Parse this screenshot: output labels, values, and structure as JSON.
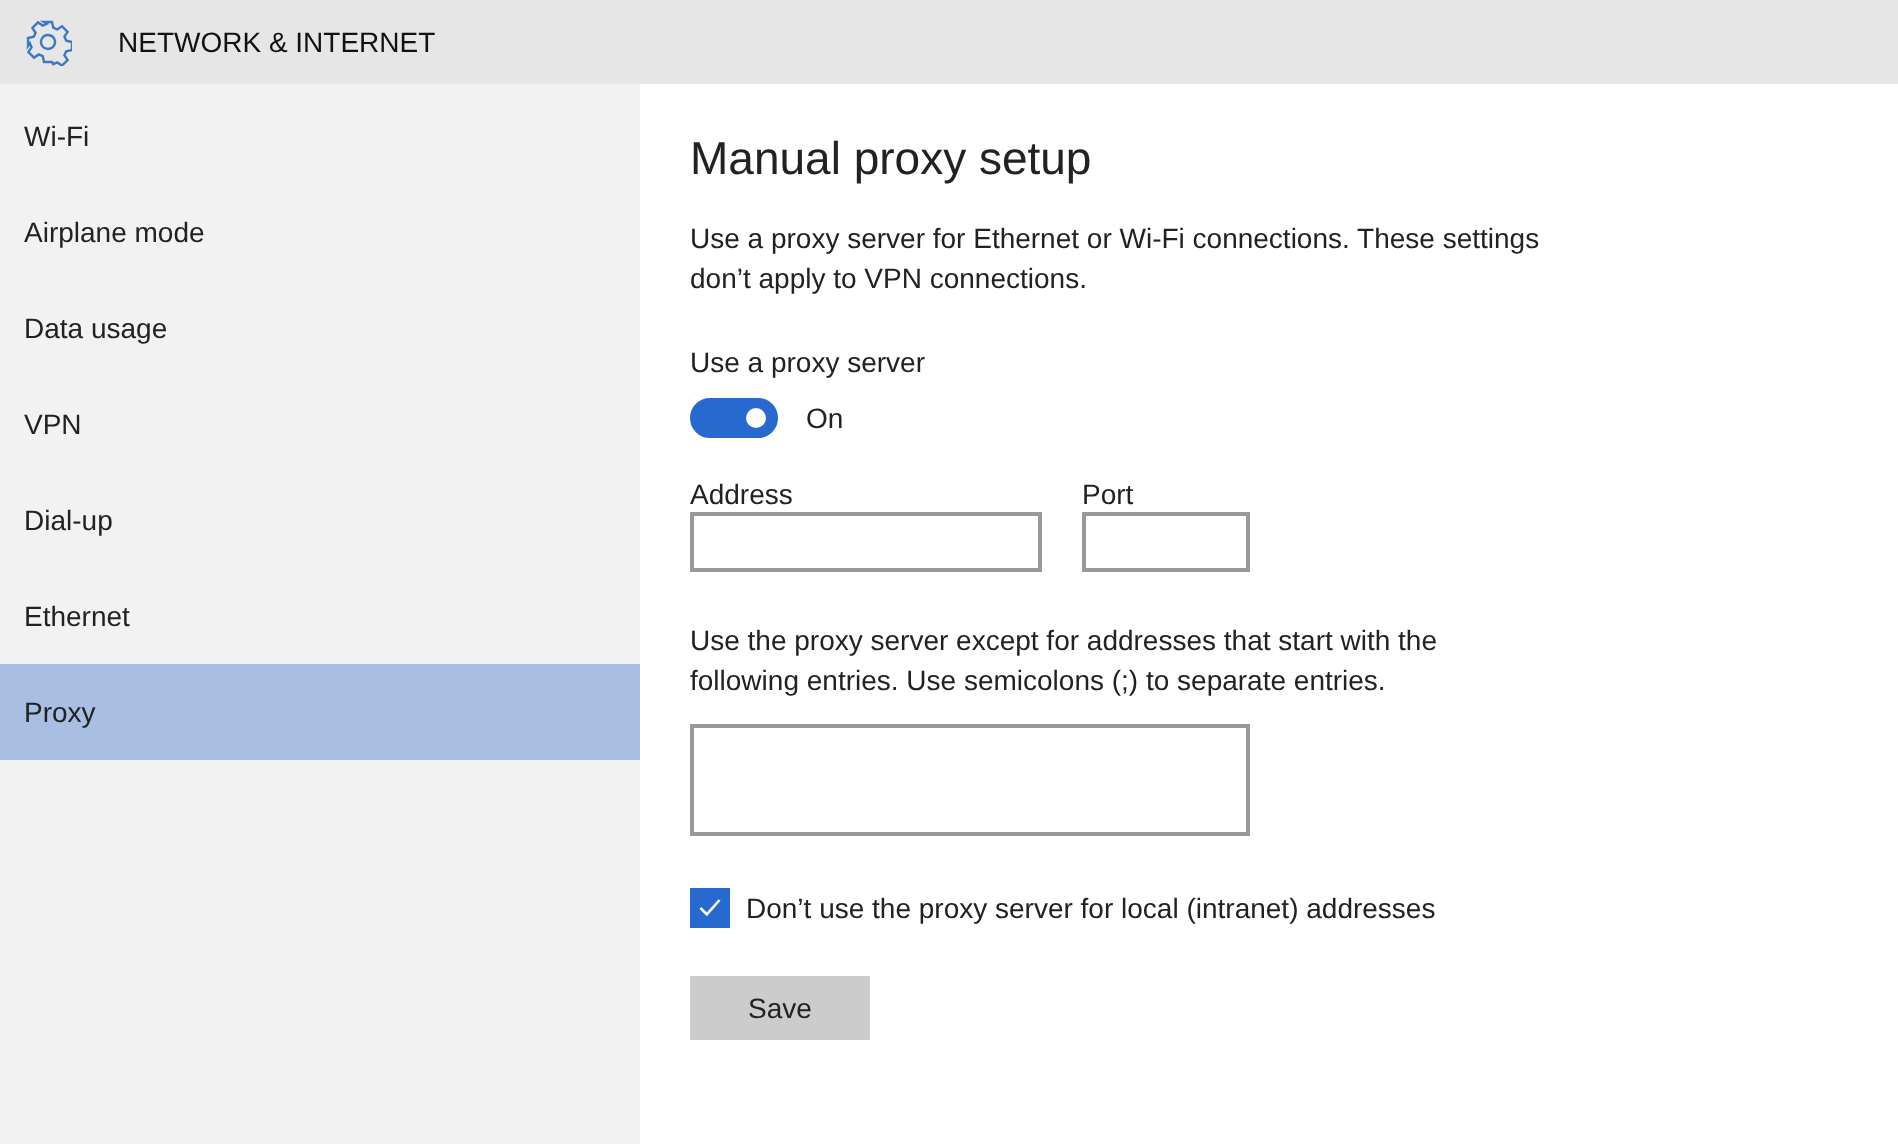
{
  "header": {
    "title": "NETWORK & INTERNET"
  },
  "sidebar": {
    "items": [
      {
        "label": "Wi-Fi",
        "selected": false
      },
      {
        "label": "Airplane mode",
        "selected": false
      },
      {
        "label": "Data usage",
        "selected": false
      },
      {
        "label": "VPN",
        "selected": false
      },
      {
        "label": "Dial-up",
        "selected": false
      },
      {
        "label": "Ethernet",
        "selected": false
      },
      {
        "label": "Proxy",
        "selected": true
      }
    ]
  },
  "main": {
    "heading": "Manual proxy setup",
    "description": "Use a proxy server for Ethernet or Wi-Fi connections. These settings don’t apply to VPN connections.",
    "toggle_label": "Use a proxy server",
    "toggle": {
      "on": true,
      "state_text": "On"
    },
    "address_label": "Address",
    "port_label": "Port",
    "exceptions_text": "Use the proxy server except for addresses that start with the following entries. Use semicolons (;) to separate entries.",
    "local_checkbox": {
      "label": "Don’t use the proxy server for local (intranet) addresses",
      "checked": true
    },
    "save_button": "Save"
  }
}
